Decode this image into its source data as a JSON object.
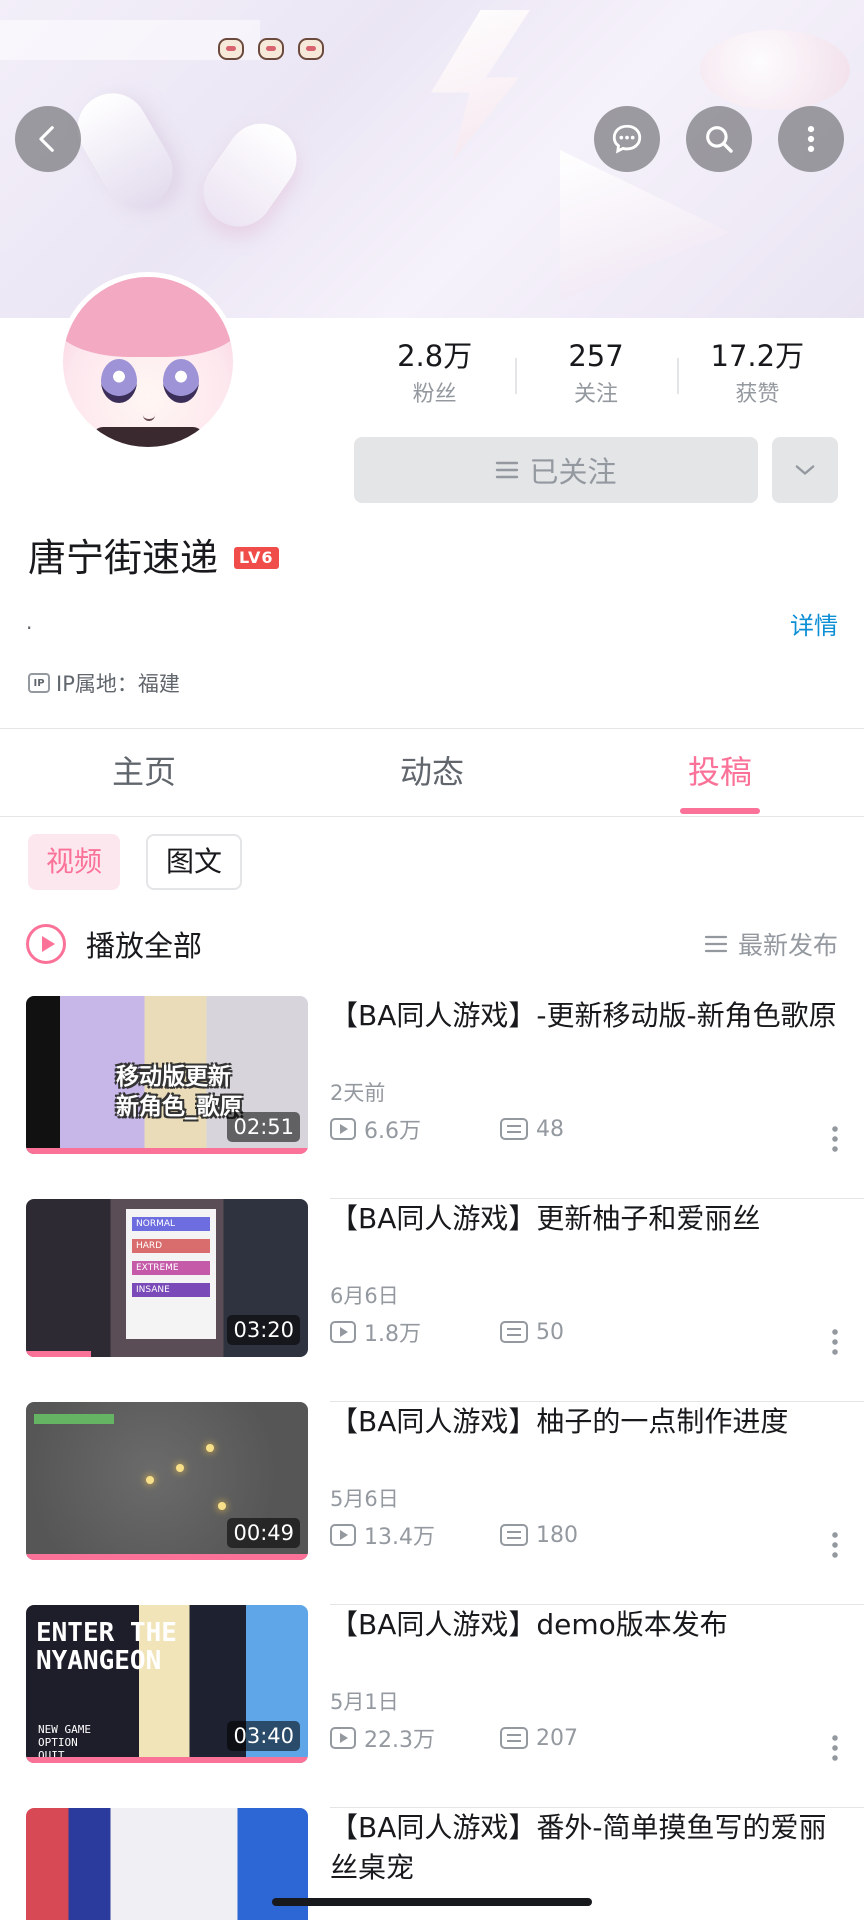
{
  "header": {
    "back_icon": "chevron-left-icon",
    "chat_icon": "chat-bubble-icon",
    "search_icon": "search-icon",
    "more_icon": "more-vertical-icon"
  },
  "profile": {
    "name": "唐宁街速递",
    "level_badge": "LV6",
    "signature": ".",
    "detail_link": "详情",
    "ip_badge": "IP",
    "ip_location": "IP属地：福建"
  },
  "stats": [
    {
      "value": "2.8万",
      "label": "粉丝"
    },
    {
      "value": "257",
      "label": "关注"
    },
    {
      "value": "17.2万",
      "label": "获赞"
    }
  ],
  "follow": {
    "label": "已关注"
  },
  "tabs": [
    {
      "label": "主页",
      "active": false
    },
    {
      "label": "动态",
      "active": false
    },
    {
      "label": "投稿",
      "active": true
    }
  ],
  "chips": [
    {
      "label": "视频",
      "active": true
    },
    {
      "label": "图文",
      "active": false
    }
  ],
  "list_header": {
    "play_all": "播放全部",
    "sort": "最新发布"
  },
  "videos": [
    {
      "title": "【BA同人游戏】-更新移动版-新角色歌原",
      "date": "2天前",
      "views": "6.6万",
      "danmaku": "48",
      "duration": "02:51",
      "thumb_text": "移动版更新\n新角色_歌原",
      "watched_progress": 1.0
    },
    {
      "title": "【BA同人游戏】更新柚子和爱丽丝",
      "date": "6月6日",
      "views": "1.8万",
      "danmaku": "50",
      "duration": "03:20",
      "difficulty_options": [
        "NORMAL",
        "HARD",
        "EXTREME",
        "INSANE"
      ],
      "watched_progress": 0.23
    },
    {
      "title": "【BA同人游戏】柚子的一点制作进度",
      "date": "5月6日",
      "views": "13.4万",
      "danmaku": "180",
      "duration": "00:49",
      "watched_progress": 1.0
    },
    {
      "title": "【BA同人游戏】demo版本发布",
      "date": "5月1日",
      "views": "22.3万",
      "danmaku": "207",
      "duration": "03:40",
      "thumb_text": "ENTER THE\nNYANGEON",
      "menu_text": "NEW GAME\nOPTION\nQUIT",
      "watched_progress": 1.0
    },
    {
      "title": "【BA同人游戏】番外-简单摸鱼写的爱丽丝桌宠",
      "date": "",
      "views": "",
      "danmaku": "",
      "duration": "",
      "watched_progress": 0
    }
  ],
  "colors": {
    "accent": "#fb7299",
    "link": "#0d8fd6",
    "level_badge": "#f04c49",
    "muted": "#9499a0"
  }
}
